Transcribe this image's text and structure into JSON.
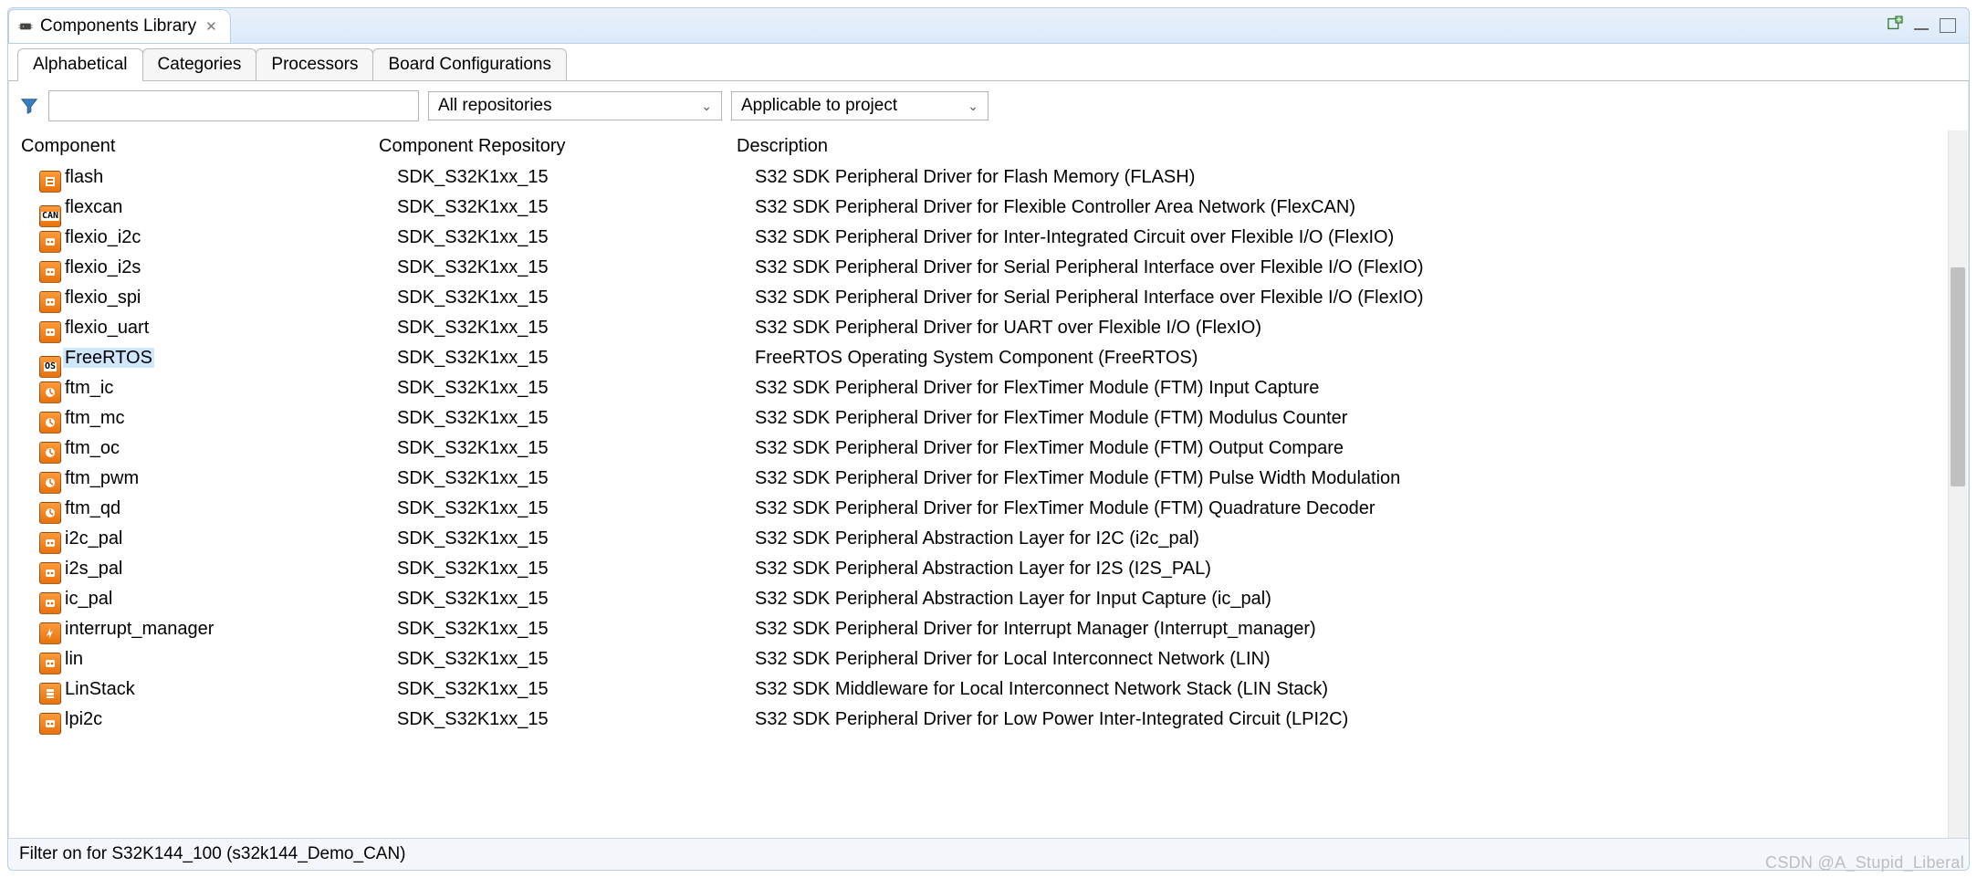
{
  "window": {
    "title": "Components Library"
  },
  "title_controls": {
    "add_view": "add-view",
    "minimize": "minimize",
    "maximize": "maximize"
  },
  "subtabs": [
    {
      "label": "Alphabetical",
      "active": true
    },
    {
      "label": "Categories",
      "active": false
    },
    {
      "label": "Processors",
      "active": false
    },
    {
      "label": "Board Configurations",
      "active": false
    }
  ],
  "filter": {
    "search_value": "",
    "repo_combo": "All repositories",
    "scope_combo": "Applicable to project"
  },
  "columns": {
    "component": "Component",
    "repository": "Component Repository",
    "description": "Description"
  },
  "rows": [
    {
      "icon": "flash",
      "name": "flash",
      "repo": "SDK_S32K1xx_15",
      "desc": "S32 SDK Peripheral Driver for Flash Memory (FLASH)"
    },
    {
      "icon": "can",
      "name": "flexcan",
      "repo": "SDK_S32K1xx_15",
      "desc": "S32 SDK Peripheral Driver for Flexible Controller Area Network (FlexCAN)"
    },
    {
      "icon": "phone",
      "name": "flexio_i2c",
      "repo": "SDK_S32K1xx_15",
      "desc": "S32 SDK Peripheral Driver for Inter-Integrated Circuit over Flexible I/O (FlexIO)"
    },
    {
      "icon": "phone",
      "name": "flexio_i2s",
      "repo": "SDK_S32K1xx_15",
      "desc": "S32 SDK Peripheral Driver for Serial Peripheral Interface over Flexible I/O (FlexIO)"
    },
    {
      "icon": "phone",
      "name": "flexio_spi",
      "repo": "SDK_S32K1xx_15",
      "desc": "S32 SDK Peripheral Driver for Serial Peripheral Interface over Flexible I/O (FlexIO)"
    },
    {
      "icon": "phone",
      "name": "flexio_uart",
      "repo": "SDK_S32K1xx_15",
      "desc": "S32 SDK Peripheral Driver for UART over Flexible I/O (FlexIO)"
    },
    {
      "icon": "os",
      "name": "FreeRTOS",
      "repo": "SDK_S32K1xx_15",
      "desc": "FreeRTOS Operating System Component (FreeRTOS)",
      "selected": true
    },
    {
      "icon": "clock",
      "name": "ftm_ic",
      "repo": "SDK_S32K1xx_15",
      "desc": "S32 SDK Peripheral Driver for FlexTimer Module (FTM) Input Capture"
    },
    {
      "icon": "clock",
      "name": "ftm_mc",
      "repo": "SDK_S32K1xx_15",
      "desc": "S32 SDK Peripheral Driver for FlexTimer Module (FTM) Modulus Counter"
    },
    {
      "icon": "clock",
      "name": "ftm_oc",
      "repo": "SDK_S32K1xx_15",
      "desc": "S32 SDK Peripheral Driver for FlexTimer Module (FTM) Output Compare"
    },
    {
      "icon": "clock",
      "name": "ftm_pwm",
      "repo": "SDK_S32K1xx_15",
      "desc": "S32 SDK Peripheral Driver for FlexTimer Module (FTM) Pulse Width Modulation"
    },
    {
      "icon": "clock",
      "name": "ftm_qd",
      "repo": "SDK_S32K1xx_15",
      "desc": "S32 SDK Peripheral Driver for FlexTimer Module (FTM) Quadrature Decoder"
    },
    {
      "icon": "phone",
      "name": "i2c_pal",
      "repo": "SDK_S32K1xx_15",
      "desc": "S32 SDK Peripheral Abstraction Layer for I2C (i2c_pal)"
    },
    {
      "icon": "phone",
      "name": "i2s_pal",
      "repo": "SDK_S32K1xx_15",
      "desc": "S32 SDK Peripheral Abstraction Layer for I2S (I2S_PAL)"
    },
    {
      "icon": "phone",
      "name": "ic_pal",
      "repo": "SDK_S32K1xx_15",
      "desc": "S32 SDK Peripheral Abstraction Layer for Input Capture (ic_pal)"
    },
    {
      "icon": "int",
      "name": "interrupt_manager",
      "repo": "SDK_S32K1xx_15",
      "desc": "S32 SDK Peripheral Driver for Interrupt Manager (Interrupt_manager)"
    },
    {
      "icon": "phone",
      "name": "lin",
      "repo": "SDK_S32K1xx_15",
      "desc": "S32 SDK Peripheral Driver for Local Interconnect Network (LIN)"
    },
    {
      "icon": "stack",
      "name": "LinStack",
      "repo": "SDK_S32K1xx_15",
      "desc": "S32 SDK Middleware for Local Interconnect Network Stack (LIN Stack)"
    },
    {
      "icon": "phone",
      "name": "lpi2c",
      "repo": "SDK_S32K1xx_15",
      "desc": "S32 SDK Peripheral Driver for Low Power Inter-Integrated Circuit (LPI2C)"
    }
  ],
  "status": "Filter on for S32K144_100 (s32k144_Demo_CAN)",
  "watermark": "CSDN @A_Stupid_Liberal"
}
